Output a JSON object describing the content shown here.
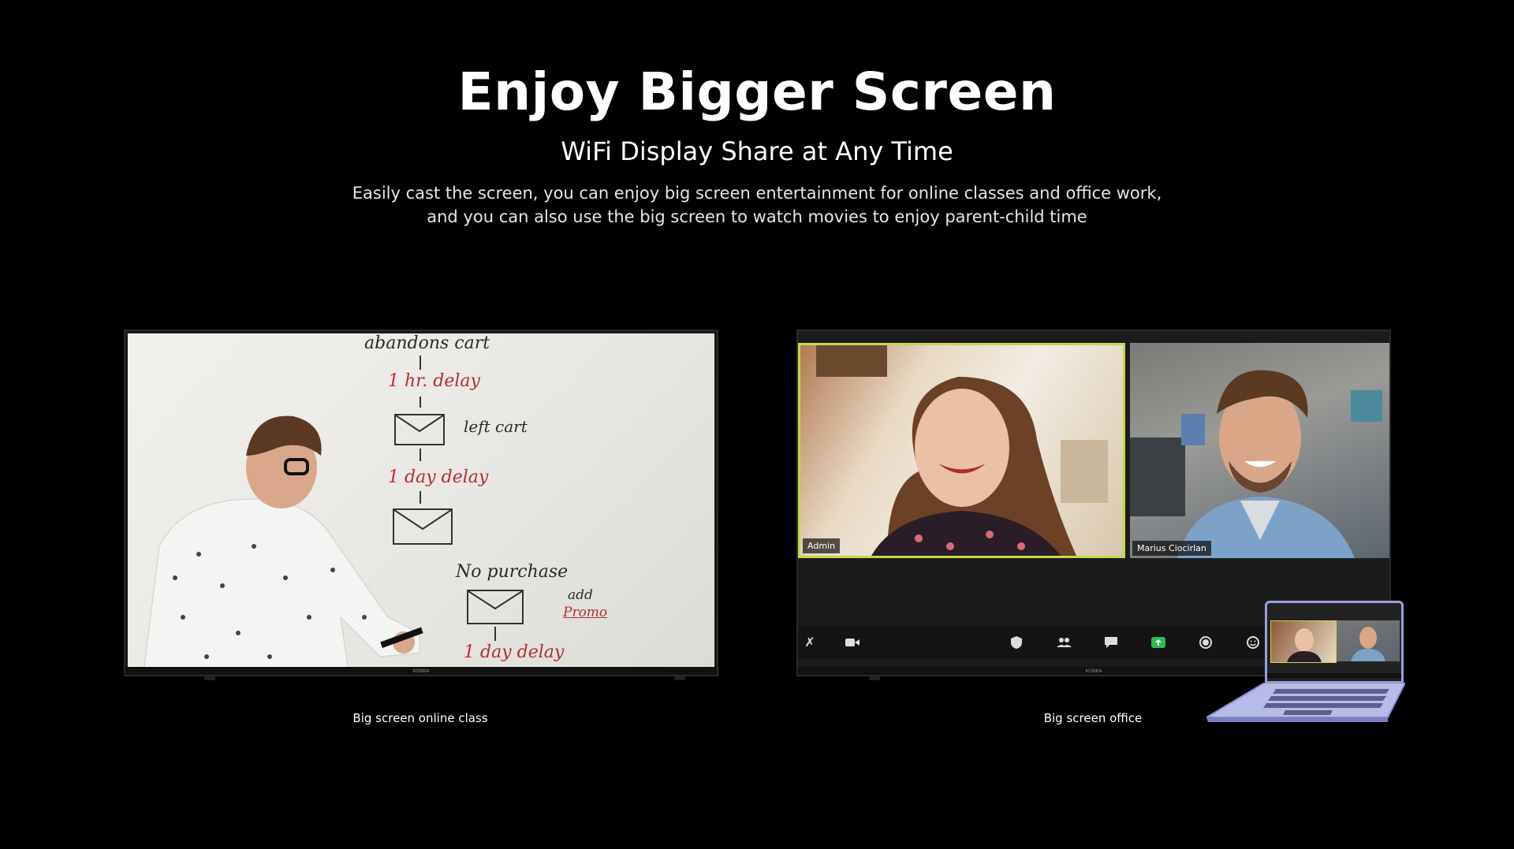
{
  "header": {
    "title": "Enjoy Bigger Screen",
    "subtitle": "WiFi Display Share at Any Time",
    "description_line1": "Easily cast the screen, you can enjoy big screen entertainment for online classes and office work,",
    "description_line2": "and you can also use the big screen to watch movies to enjoy parent-child time"
  },
  "tv_class": {
    "brand": "KONKA",
    "caption": "Big screen online class",
    "whiteboard": {
      "line1": "abandons cart",
      "line2": "1 hr. delay",
      "line3": "left cart",
      "line4": "1 day delay",
      "line5": "No purchase",
      "line6": "add",
      "line7": "Promo",
      "line8": "1 day delay"
    }
  },
  "tv_office": {
    "brand": "KONKA",
    "caption": "Big screen office",
    "participant_left": "Admin",
    "participant_right": "Marius Ciocirlan",
    "toolbar_icons": [
      "mic-icon",
      "camera-icon",
      "shield-icon",
      "participants-icon",
      "chat-icon",
      "share-screen-icon",
      "record-icon",
      "reactions-icon"
    ]
  },
  "colors": {
    "background": "#000000",
    "active_speaker_border": "#c5d84a",
    "share_green": "#2bbd4e",
    "laptop_frame": "#9aa0d8"
  }
}
